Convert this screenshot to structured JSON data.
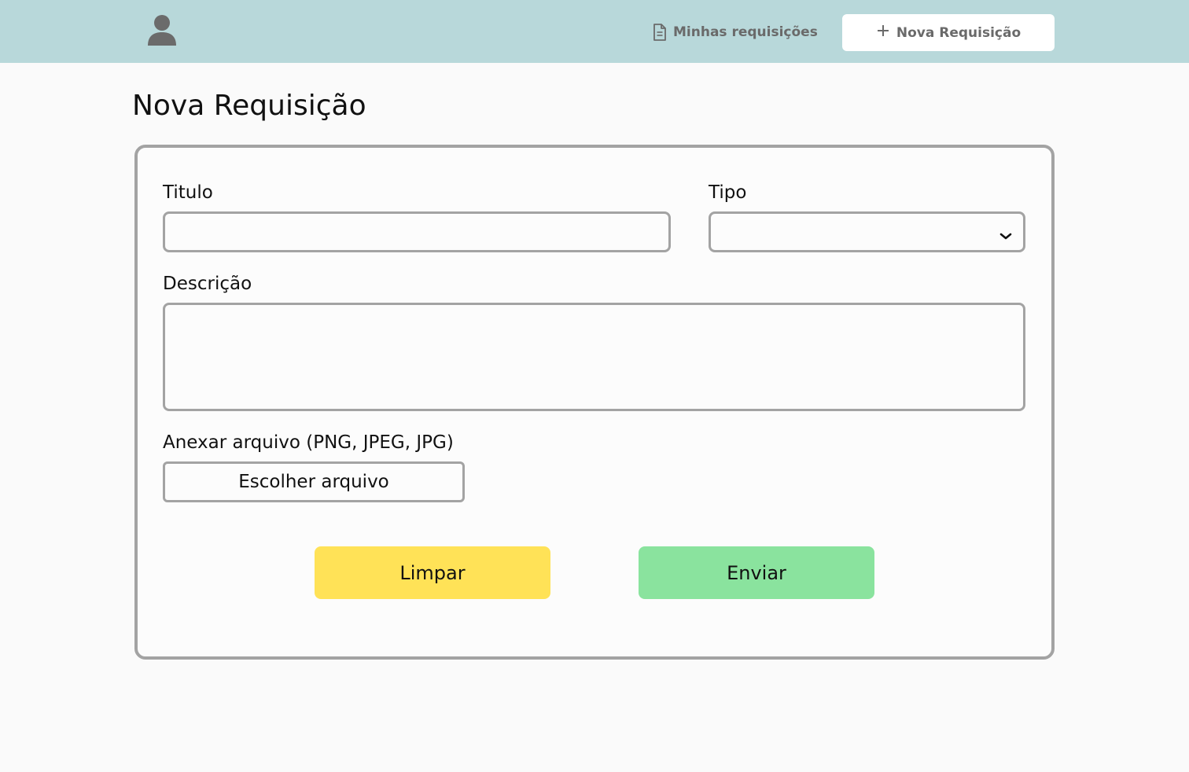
{
  "header": {
    "avatar_icon": "user-icon",
    "nav_link": {
      "label": "Minhas requisições",
      "icon": "document-icon"
    },
    "new_button": {
      "label": "Nova Requisição",
      "icon": "plus-icon"
    }
  },
  "page": {
    "title": "Nova Requisição"
  },
  "form": {
    "title_field": {
      "label": "Titulo",
      "value": "",
      "placeholder": ""
    },
    "type_field": {
      "label": "Tipo",
      "value": ""
    },
    "description_field": {
      "label": "Descrição",
      "value": "",
      "placeholder": ""
    },
    "attachment": {
      "label": "Anexar arquivo (PNG, JPEG, JPG)",
      "button_label": "Escolher arquivo"
    },
    "clear_button": {
      "label": "Limpar",
      "color": "#ffe257"
    },
    "submit_button": {
      "label": "Enviar",
      "color": "#8ae39e"
    }
  },
  "colors": {
    "header_bg": "#b8d8da",
    "page_bg": "#fafafa",
    "border": "#a3a3a3"
  }
}
